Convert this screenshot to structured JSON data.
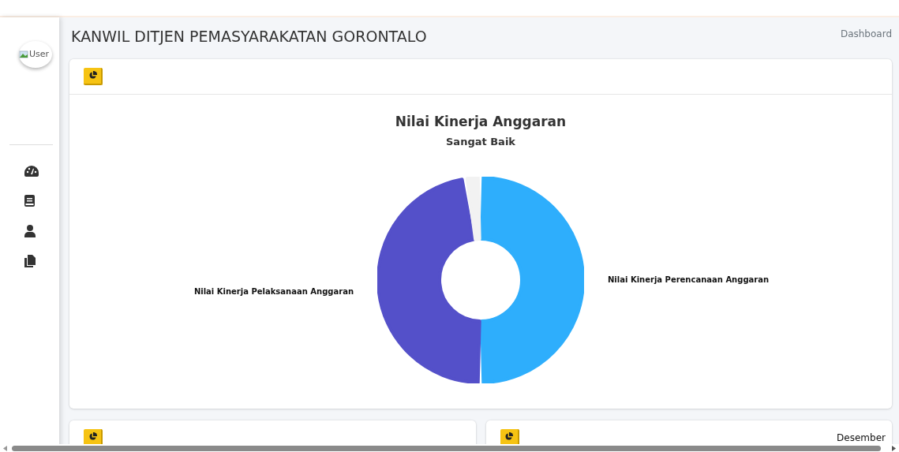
{
  "sidebar": {
    "user_image_alt": "User",
    "items": [
      {
        "kind": "gauge"
      },
      {
        "kind": "book"
      },
      {
        "kind": "user"
      },
      {
        "kind": "copy"
      }
    ]
  },
  "header": {
    "title": "KANWIL DITJEN PEMASYARAKATAN GORONTALO",
    "breadcrumb": "Dashboard"
  },
  "main_card": {
    "chart": {
      "title": "Nilai Kinerja Anggaran",
      "subtitle": "Sangat Baik",
      "segments": [
        {
          "label": "Nilai Kinerja Perencanaan Anggaran",
          "color": "#2eaefc"
        },
        {
          "label": "Nilai Kinerja Pelaksanaan Anggaran",
          "color": "#5450c9"
        },
        {
          "color": "#f2f2f2"
        }
      ]
    }
  },
  "bottom_cards": [
    {
      "kind": "chart"
    },
    {
      "kind": "chart",
      "month": "Desember"
    }
  ]
}
